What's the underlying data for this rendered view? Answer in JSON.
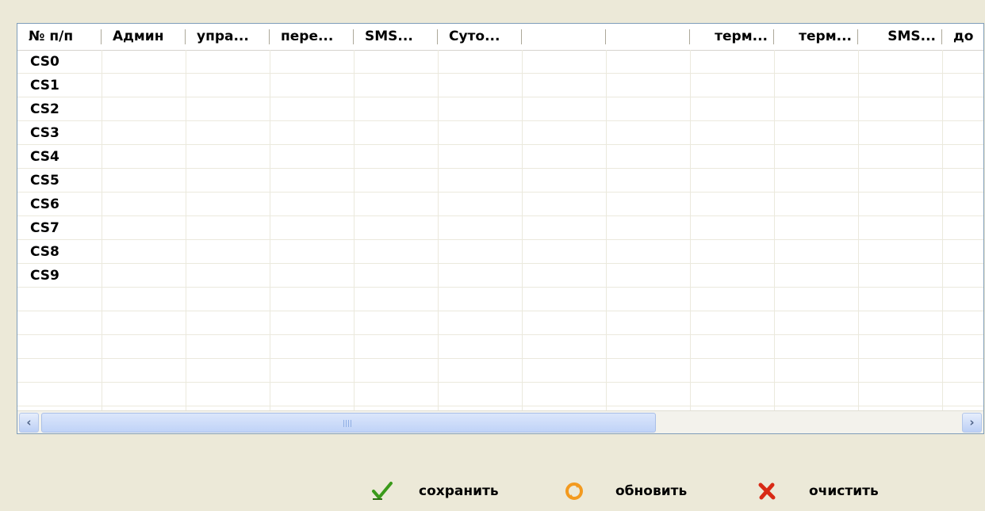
{
  "table": {
    "columns": [
      "№ п/п",
      "Админ",
      "упра...",
      "пере...",
      "SMS...",
      "Суто...",
      "",
      "",
      "терм...",
      "терм...",
      "SMS...",
      "до"
    ],
    "rows": [
      "CS0",
      "CS1",
      "CS2",
      "CS3",
      "CS4",
      "CS5",
      "CS6",
      "CS7",
      "CS8",
      "CS9"
    ]
  },
  "scrollbar": {
    "left_icon": "arrow-left-icon",
    "right_icon": "arrow-right-icon"
  },
  "actions": {
    "save": {
      "label": "сохранить",
      "icon": "checkmark-icon",
      "color": "#3a9a1a"
    },
    "refresh": {
      "label": "обновить",
      "icon": "refresh-icon",
      "color": "#f39a1f"
    },
    "clear": {
      "label": "очистить",
      "icon": "cross-icon",
      "color": "#d82a15"
    }
  }
}
